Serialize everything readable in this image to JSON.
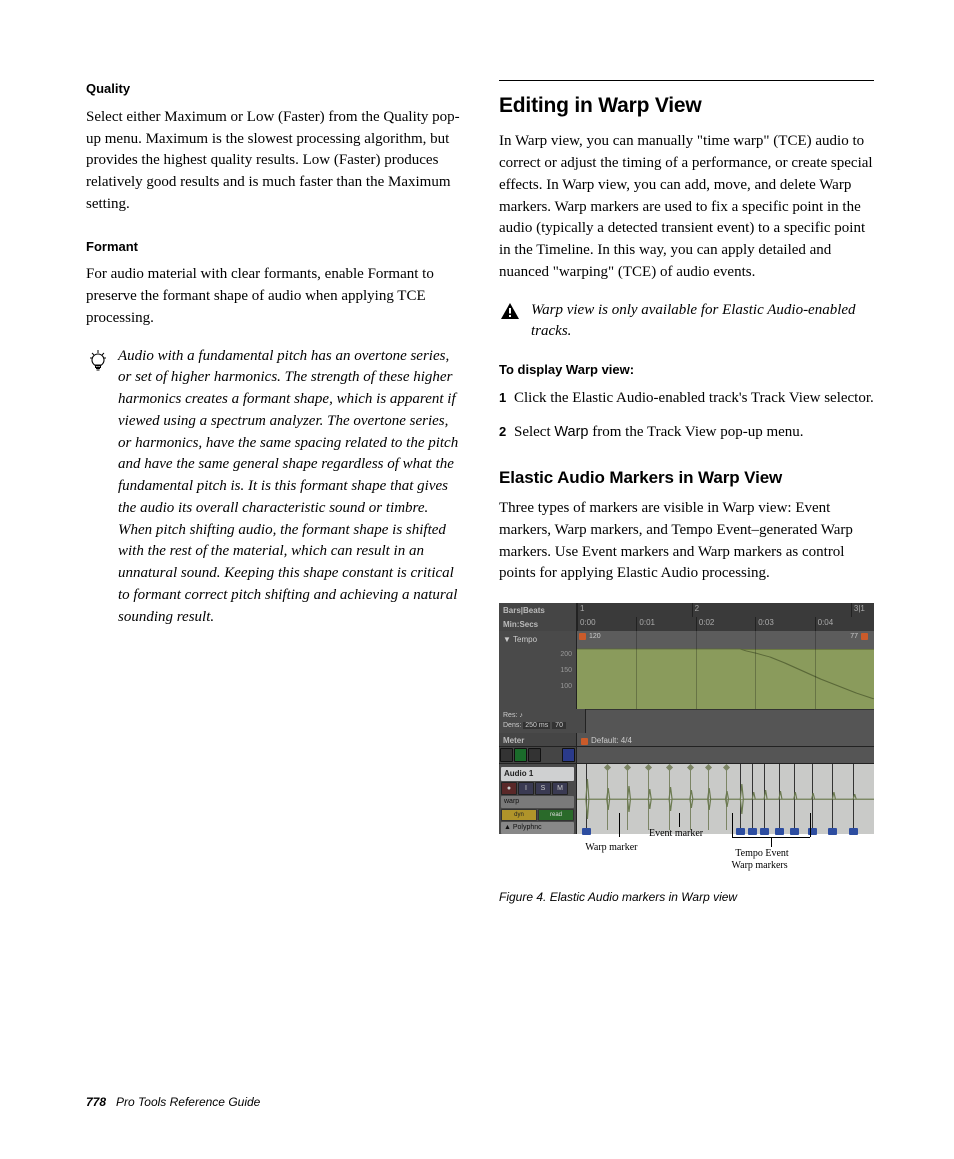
{
  "left": {
    "quality_heading": "Quality",
    "quality_body": "Select either Maximum or Low (Faster) from the Quality pop-up menu. Maximum is the slowest processing algorithm, but provides the highest quality results. Low (Faster) produces relatively good results and is much faster than the Maximum setting.",
    "formant_heading": "Formant",
    "formant_body": "For audio material with clear formants, enable Formant to preserve the formant shape of audio when applying TCE processing.",
    "tip_text": "Audio with a fundamental pitch has an overtone series, or set of higher harmonics. The strength of these higher harmonics creates a formant shape, which is apparent if viewed using a spectrum analyzer. The overtone series, or harmonics, have the same spacing related to the pitch and have the same general shape regardless of what the fundamental pitch is. It is this formant shape that gives the audio its overall characteristic sound or timbre. When pitch shifting audio, the formant shape is shifted with the rest of the material, which can result in an unnatural sound. Keeping this shape constant is critical to formant correct pitch shifting and achieving a natural sounding result."
  },
  "right": {
    "h1": "Editing in Warp View",
    "intro": "In Warp view, you can manually \"time warp\" (TCE) audio to correct or adjust the timing of a performance, or create special effects. In Warp view, you can add, move, and delete Warp markers. Warp markers are used to fix a specific point in the audio (typically a detected transient event) to a specific point in the Timeline. In this way, you can apply detailed and nuanced \"warping\" (TCE) of audio events.",
    "warn_text": "Warp view is only available for Elastic Audio-enabled tracks.",
    "task_heading": "To display Warp view:",
    "step1_num": "1",
    "step1_text": " Click the Elastic Audio-enabled track's Track View selector.",
    "step2_num": "2",
    "step2_text_a": " Select ",
    "step2_text_b": "Warp",
    "step2_text_c": " from the Track View pop-up menu.",
    "h2": "Elastic Audio Markers in Warp View",
    "markers_body": "Three types of markers are visible in Warp view: Event markers, Warp markers, and Tempo Event–generated Warp markers. Use Event markers and Warp markers as control points for applying Elastic Audio processing.",
    "figure": {
      "ruler_bars": "Bars|Beats",
      "ruler_min": "Min:Secs",
      "bar_labels": [
        "1",
        "2",
        "3|1"
      ],
      "time_labels": [
        "0:00",
        "0:01",
        "0:02",
        "0:03",
        "0:04"
      ],
      "tempo_label": "Tempo",
      "tempo_start": "120",
      "tempo_end": "77",
      "tempo_ticks": [
        "200",
        "150",
        "100"
      ],
      "res_label": "Res:",
      "dens_label": "Dens:",
      "dens_value": "250 ms",
      "axis70": "70",
      "meter_label": "Meter",
      "meter_value": "Default: 4/4",
      "track_name": "Audio 1",
      "track_btns": [
        "●",
        "I",
        "S",
        "M"
      ],
      "view_sel": "warp",
      "dyn": "dyn",
      "read": "read",
      "algo": "Polyphnc",
      "callout_event": "Event marker",
      "callout_warp": "Warp marker",
      "callout_tempo1": "Tempo Event",
      "callout_tempo2": "Warp markers",
      "caption": "Figure 4.  Elastic Audio markers in Warp view"
    }
  },
  "footer": {
    "page_number": "778",
    "book_title": "Pro Tools Reference Guide"
  }
}
